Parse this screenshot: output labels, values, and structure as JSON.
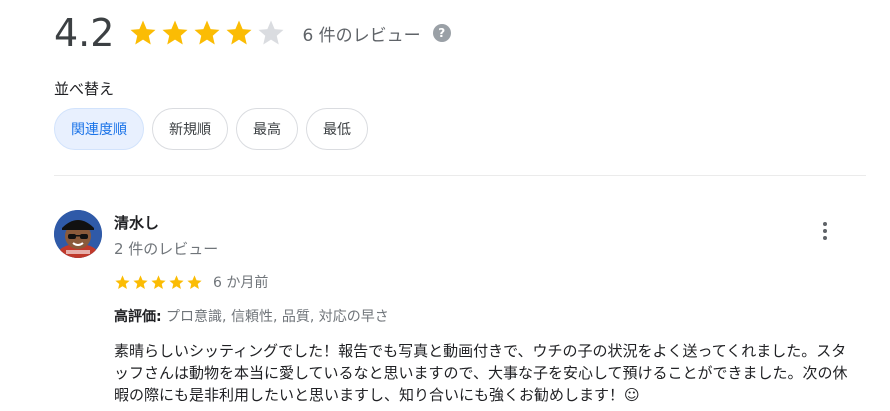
{
  "summary": {
    "score": "4.2",
    "rating_value": 4.2,
    "rating_max": 5,
    "review_count_label": "6 件のレビュー",
    "help_icon_glyph": "?"
  },
  "sort": {
    "label": "並べ替え",
    "options": [
      "関連度順",
      "新規順",
      "最高",
      "最低"
    ],
    "selected": "関連度順"
  },
  "review": {
    "author": "清水し",
    "author_review_count": "2 件のレビュー",
    "rating_value": 5,
    "rating_max": 5,
    "date": "6 か月前",
    "highlights_label": "高評価:",
    "highlights_text": " プロ意識, 信頼性, 品質, 対応の早さ",
    "text": "素晴らしいシッティングでした！報告でも写真と動画付きで、ウチの子の状況をよく送ってくれました。スタッフさんは動物を本当に愛しているなと思いますので、大事な子を安心して預けることができました。次の休暇の際にも是非利用したいと思いますし、知り合いにも強くお勧めします！☺"
  },
  "colors": {
    "star_filled": "#fbbc04",
    "star_empty": "#dadce0",
    "chip_selected_bg": "#e8f0fe",
    "chip_selected_text": "#1a73e8"
  },
  "icons": {
    "star": "star-icon",
    "help": "help-circle-icon",
    "more": "more-vert-icon"
  }
}
